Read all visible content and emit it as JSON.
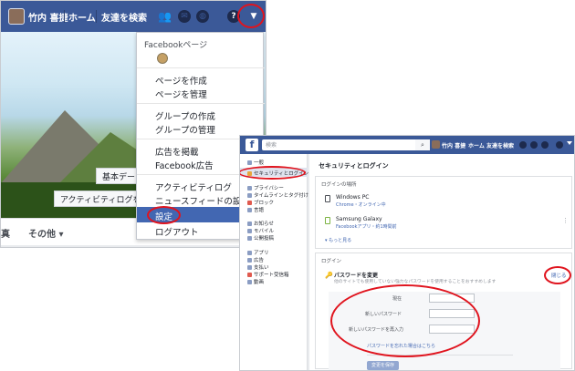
{
  "colors": {
    "facebook_blue": "#3b5998",
    "highlight_red": "#e0141e",
    "menu_selected": "#4267b2"
  },
  "left": {
    "topbar": {
      "user_name": "竹内 喜捷",
      "home": "ホーム",
      "find_friends": "友達を検索",
      "icons": [
        "friends-icon",
        "messenger-icon",
        "globe-icon",
        "help-icon",
        "chevron-down-icon"
      ]
    },
    "cover": {
      "basic_data": "基本デー",
      "activity_log": "アクティビティログを"
    },
    "tabs": {
      "partial": "真",
      "more": "その他 ▾"
    },
    "menu": {
      "pages_header": "Facebookページ",
      "create_page": "ページを作成",
      "manage_pages": "ページを管理",
      "create_group": "グループの作成",
      "manage_groups": "グループの管理",
      "ads": "広告を掲載",
      "fb_ads": "Facebook広告",
      "activity_log": "アクティビティログ",
      "news_feed_settings": "ニュースフィードの設定",
      "settings": "設定",
      "logout": "ログアウト"
    }
  },
  "right": {
    "search_placeholder": "検索",
    "topbar": {
      "user_name": "竹内 喜捷",
      "home": "ホーム",
      "find_friends": "友達を検索"
    },
    "sidebar": {
      "general": "一般",
      "security": "セキュリティとログイン",
      "privacy": "プライバシー",
      "timeline": "タイムラインとタグ付け",
      "blocking": "ブロック",
      "language": "言語",
      "notifications": "お知らせ",
      "mobile": "モバイル",
      "public_posts": "公開投稿",
      "apps": "アプリ",
      "ads": "広告",
      "payments": "支払い",
      "support_inbox": "サポート受信箱",
      "videos": "動画"
    },
    "page_title": "セキュリティとログイン",
    "where_logged_in": "ログインの場所",
    "devices": [
      {
        "name": "Windows PC",
        "sub": "Chrome・オンライン中"
      },
      {
        "name": "Samsung Galaxy",
        "sub": "Facebookアプリ・約1時間前"
      }
    ],
    "see_more": "▾ もっと見る",
    "login_section": "ログイン",
    "change_password": "パスワードを変更",
    "change_password_desc": "他のサイトでも使用していない強力なパスワードを使用することをおすすめします",
    "close": "閉じる",
    "form": {
      "current": "現在",
      "new": "新しいパスワード",
      "retype": "新しいパスワードを再入力",
      "forgot": "パスワードを忘れた場合はこちら",
      "save": "変更を保存"
    }
  }
}
